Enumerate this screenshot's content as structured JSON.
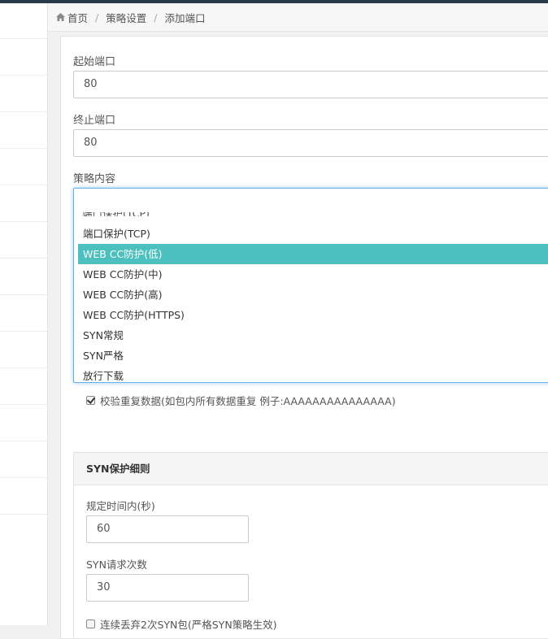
{
  "breadcrumb": {
    "home": "首页",
    "separator": "/",
    "items": [
      "策略设置",
      "添加端口"
    ]
  },
  "form": {
    "start_port": {
      "label": "起始端口",
      "value": "80"
    },
    "end_port": {
      "label": "终止端口",
      "value": "80"
    },
    "policy": {
      "label": "策略内容",
      "value": "",
      "options": [
        "端口保护(TCP)",
        "WEB CC防护(低)",
        "WEB CC防护(中)",
        "WEB CC防护(高)",
        "WEB CC防护(HTTPS)",
        "SYN常规",
        "SYN严格",
        "放行下载"
      ],
      "highlighted": "WEB CC防护(低)"
    },
    "check_repeat": {
      "label": "校验重复数据(如包内所有数据重复 例子:AAAAAAAAAAAAAAA)",
      "checked": true
    }
  },
  "syn_panel": {
    "title": "SYN保护细则",
    "time_window": {
      "label": "规定时间内(秒)",
      "value": "60"
    },
    "syn_count": {
      "label": "SYN请求次数",
      "value": "30"
    },
    "drop_syn": {
      "label": "连续丢弃2次SYN包(严格SYN策略生效)",
      "checked": false
    }
  },
  "colors": {
    "highlight": "#4cbfbf",
    "focus_border": "#66afe9"
  },
  "icons": {
    "home": "home-icon"
  }
}
